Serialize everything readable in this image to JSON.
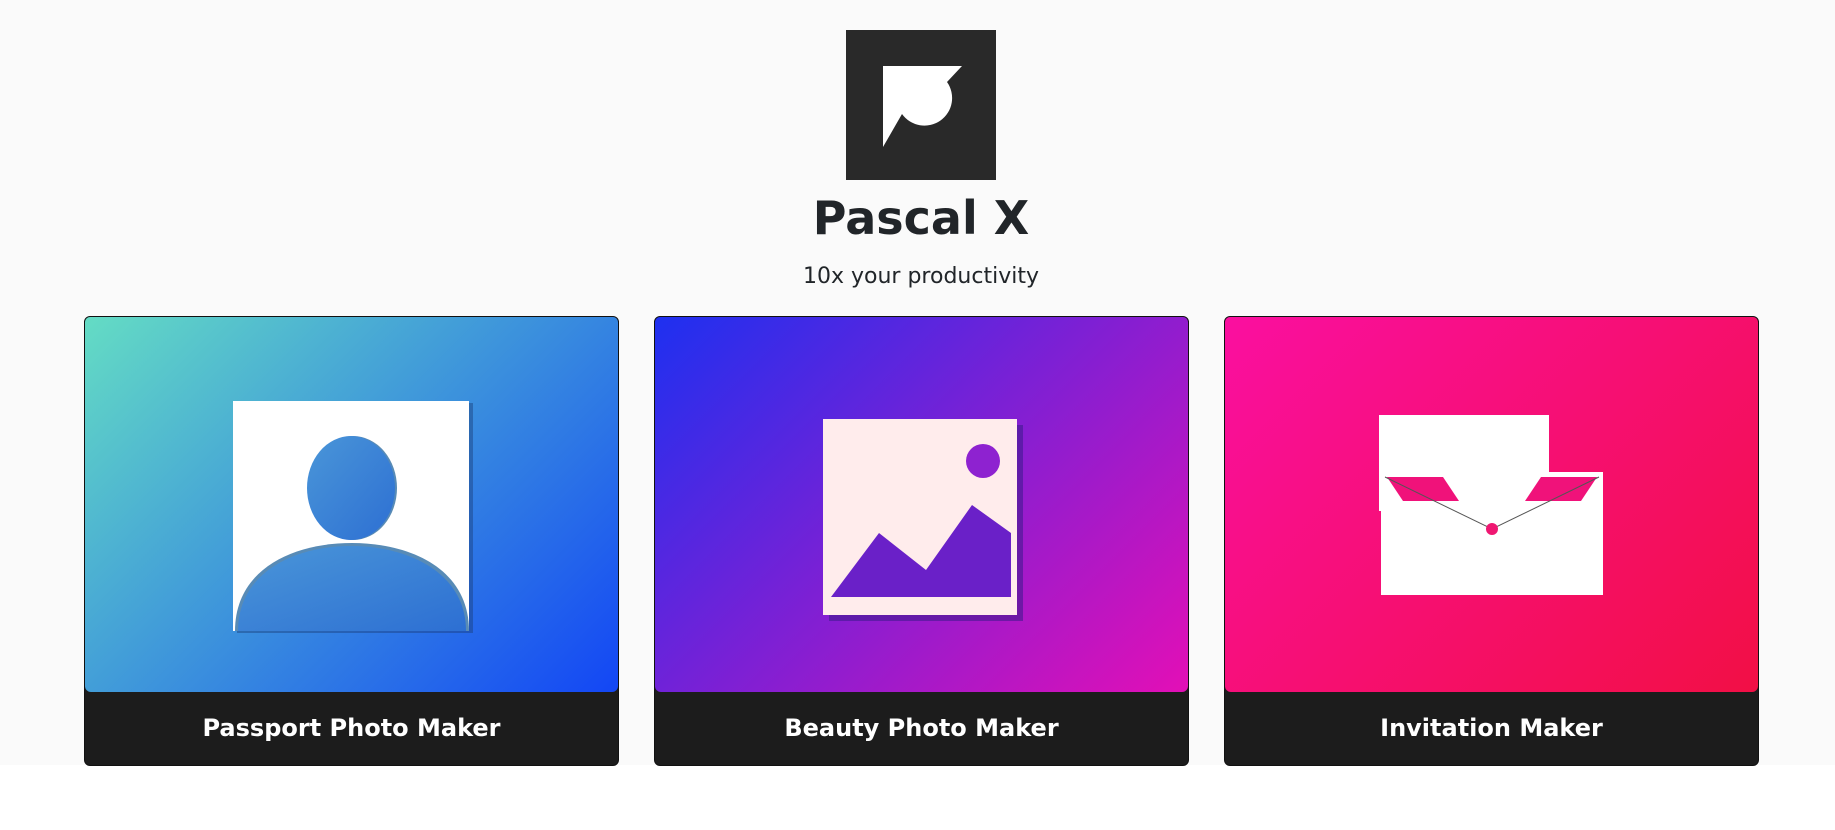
{
  "header": {
    "logo_icon": "pascal-x-logo-icon",
    "title": "Pascal X",
    "subtitle": "10x your productivity"
  },
  "cards": [
    {
      "label": "Passport Photo Maker",
      "icon": "passport-portrait-icon",
      "gradient": [
        "#64dcc4",
        "#1346f5"
      ]
    },
    {
      "label": "Beauty Photo Maker",
      "icon": "landscape-image-icon",
      "gradient": [
        "#1e30f0",
        "#e30fb6"
      ]
    },
    {
      "label": "Invitation Maker",
      "icon": "envelope-letter-icon",
      "gradient": [
        "#fa0fa0",
        "#f20f45"
      ]
    }
  ],
  "colors": {
    "page_background": "#fafafa",
    "logo_background": "#292929",
    "card_footer": "#1c1c1c",
    "text": "#212529"
  }
}
